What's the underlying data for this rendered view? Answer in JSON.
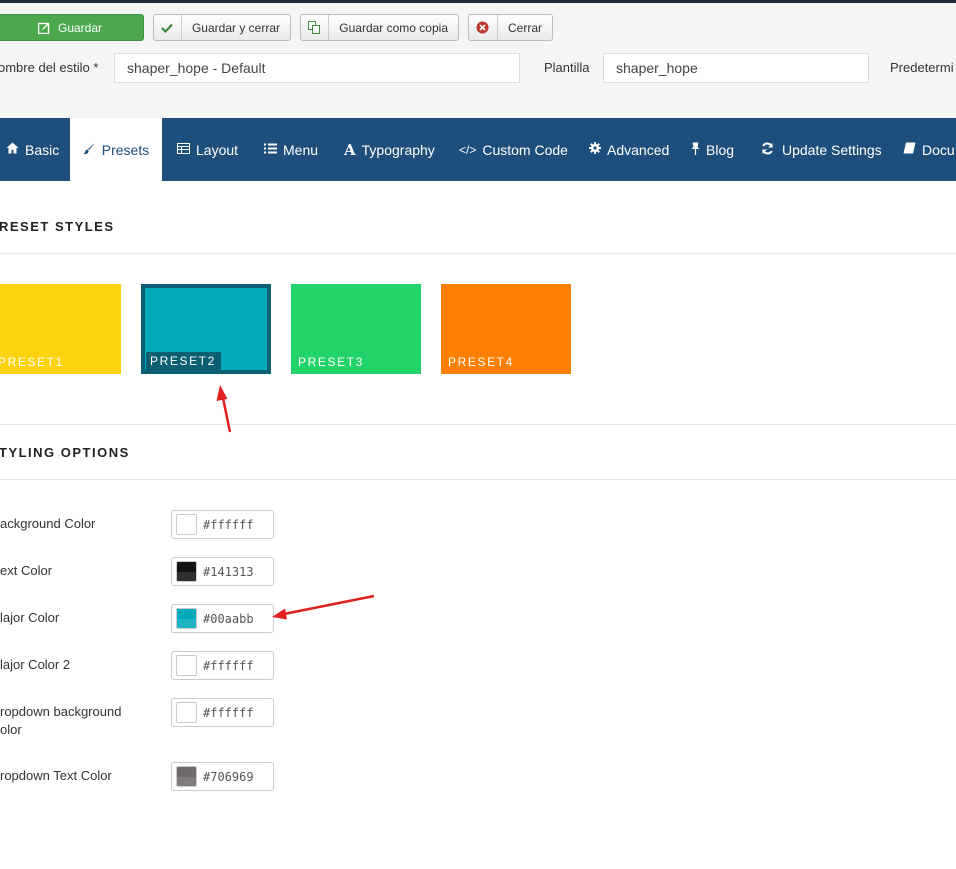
{
  "toolbar": {
    "save_label": "Guardar",
    "save_close_label": "Guardar y cerrar",
    "save_copy_label": "Guardar como copia",
    "close_label": "Cerrar"
  },
  "form": {
    "style_name_label": "ombre del estilo *",
    "style_name_value": "shaper_hope - Default",
    "template_label": "Plantilla",
    "template_value": "shaper_hope",
    "default_label": "Predetermi"
  },
  "tabs": [
    {
      "label": "Basic",
      "icon": "home-icon"
    },
    {
      "label": "Presets",
      "icon": "brush-icon",
      "active": true
    },
    {
      "label": "Layout",
      "icon": "layout-icon"
    },
    {
      "label": "Menu",
      "icon": "list-icon"
    },
    {
      "label": "Typography",
      "icon": "font-icon"
    },
    {
      "label": "Custom Code",
      "icon": "code-icon"
    },
    {
      "label": "Advanced",
      "icon": "gear-icon"
    },
    {
      "label": "Blog",
      "icon": "pin-icon"
    },
    {
      "label": "Update Settings",
      "icon": "refresh-icon"
    },
    {
      "label": "Docu",
      "icon": "book-icon"
    }
  ],
  "presets_section": {
    "title": "RESET STYLES",
    "presets": [
      {
        "name": "PRESET1",
        "color": "#ffd20f"
      },
      {
        "name": "PRESET2",
        "color": "#00aabb",
        "selected": true
      },
      {
        "name": "PRESET3",
        "color": "#22d36a"
      },
      {
        "name": "PRESET4",
        "color": "#ff8000"
      }
    ]
  },
  "styling_section": {
    "title": "TYLING OPTIONS",
    "options": [
      {
        "label": "ackground Color",
        "value": "#ffffff",
        "color": "#ffffff"
      },
      {
        "label": "ext Color",
        "value": "#141313",
        "color": "#141313"
      },
      {
        "label": "lajor Color",
        "value": "#00aabb",
        "color": "#00aabb"
      },
      {
        "label": "lajor Color 2",
        "value": "#ffffff",
        "color": "#ffffff"
      },
      {
        "label": "ropdown background olor",
        "value": "#ffffff",
        "color": "#ffffff"
      },
      {
        "label": "ropdown Text Color",
        "value": "#706969",
        "color": "#706969"
      }
    ]
  },
  "colors": {
    "tab_bar": "#1e4f7c",
    "save_button": "#4ca84c",
    "annotation_arrow": "#e02020"
  }
}
